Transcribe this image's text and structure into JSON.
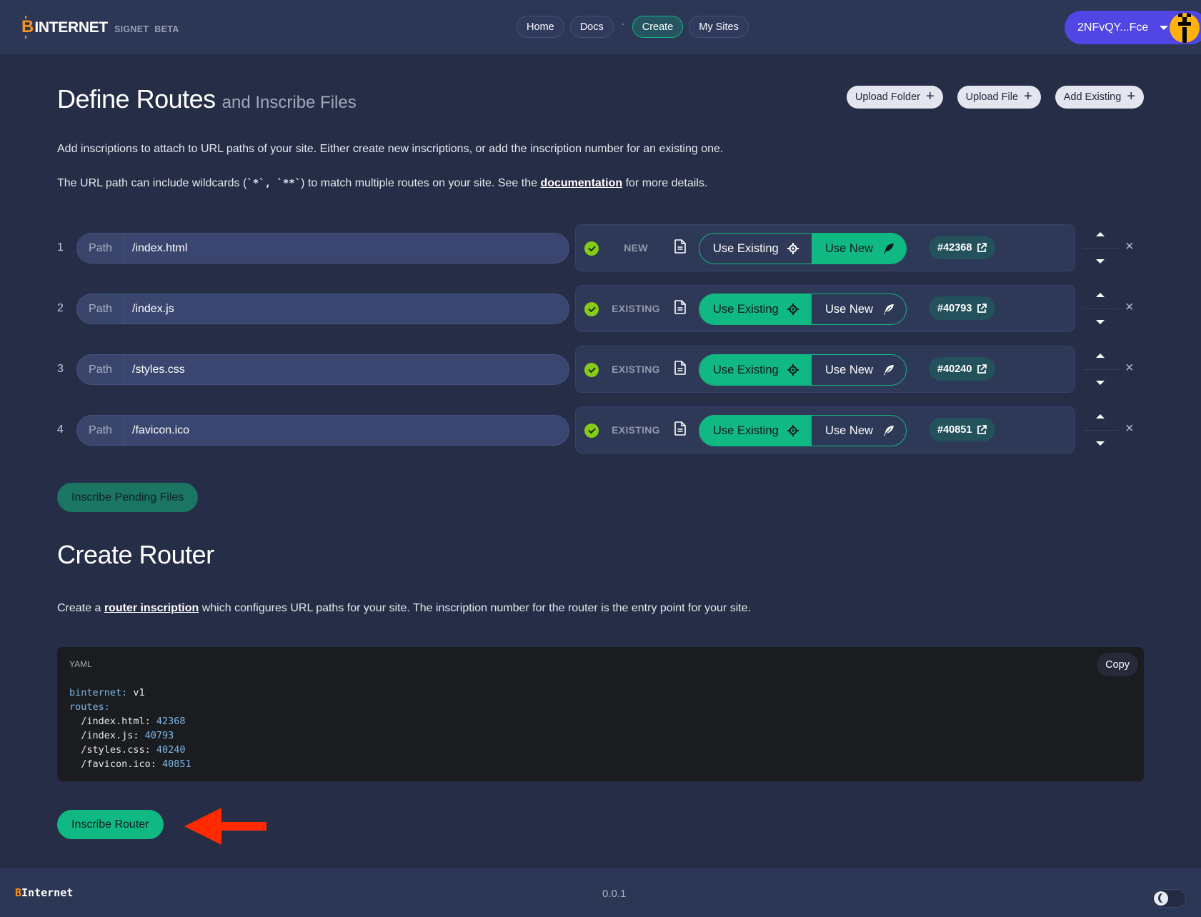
{
  "header": {
    "logo_letter": "B",
    "logo_text": "INTERNET",
    "tags": [
      "SIGNET",
      "BETA"
    ],
    "nav": [
      {
        "label": "Home",
        "active": false
      },
      {
        "label": "Docs",
        "active": false
      },
      {
        "label": "Create",
        "active": true
      },
      {
        "label": "My Sites",
        "active": false
      }
    ],
    "wallet_label": "2NFvQY...Fce"
  },
  "page": {
    "title": "Define Routes",
    "subtitle": "and Inscribe Files",
    "actions": [
      {
        "label": "Upload Folder",
        "icon": "plus-icon"
      },
      {
        "label": "Upload File",
        "icon": "plus-icon"
      },
      {
        "label": "Add Existing",
        "icon": "plus-icon"
      }
    ],
    "description_1": "Add inscriptions to attach to URL paths of your site. Either create new inscriptions, or add the inscription number for an existing one.",
    "description_2_pre": "The URL path can include wildcards (",
    "description_2_code": "`*`, `**`",
    "description_2_mid": ") to match multiple routes on your site. See the ",
    "description_2_link": "documentation",
    "description_2_post": " for more details."
  },
  "routes": {
    "path_label": "Path",
    "use_existing_label": "Use Existing",
    "use_new_label": "Use New",
    "items": [
      {
        "number": "1",
        "path": "/index.html",
        "status": "NEW",
        "mode": "new",
        "inscription": "#42368"
      },
      {
        "number": "2",
        "path": "/index.js",
        "status": "EXISTING",
        "mode": "existing",
        "inscription": "#40793"
      },
      {
        "number": "3",
        "path": "/styles.css",
        "status": "EXISTING",
        "mode": "existing",
        "inscription": "#40240"
      },
      {
        "number": "4",
        "path": "/favicon.ico",
        "status": "EXISTING",
        "mode": "existing",
        "inscription": "#40851"
      }
    ]
  },
  "inscribe_pending_label": "Inscribe Pending Files",
  "router": {
    "title": "Create Router",
    "desc_pre": "Create a ",
    "desc_link": "router inscription",
    "desc_post": " which configures URL paths for your site. The inscription number for the router is the entry point for your site.",
    "code_lang": "YAML",
    "copy_label": "Copy",
    "code_lines": [
      {
        "indent": "",
        "key": "binternet:",
        "value": " v1"
      },
      {
        "indent": "",
        "key": "routes:",
        "value": ""
      },
      {
        "indent": "  ",
        "key": "/index.html:",
        "value": " 42368"
      },
      {
        "indent": "  ",
        "key": "/index.js:",
        "value": " 40793"
      },
      {
        "indent": "  ",
        "key": "/styles.css:",
        "value": " 40240"
      },
      {
        "indent": "  ",
        "key": "/favicon.ico:",
        "value": " 40851"
      }
    ],
    "inscribe_label": "Inscribe Router"
  },
  "footer": {
    "logo_letter": "B",
    "logo_text": "Internet",
    "version": "0.0.1",
    "theme": "dark"
  },
  "colors": {
    "accent_green": "#10b981",
    "brand_orange": "#f7931a",
    "wallet_purple": "#4f46e5",
    "annotation_red": "#ff2a00"
  }
}
